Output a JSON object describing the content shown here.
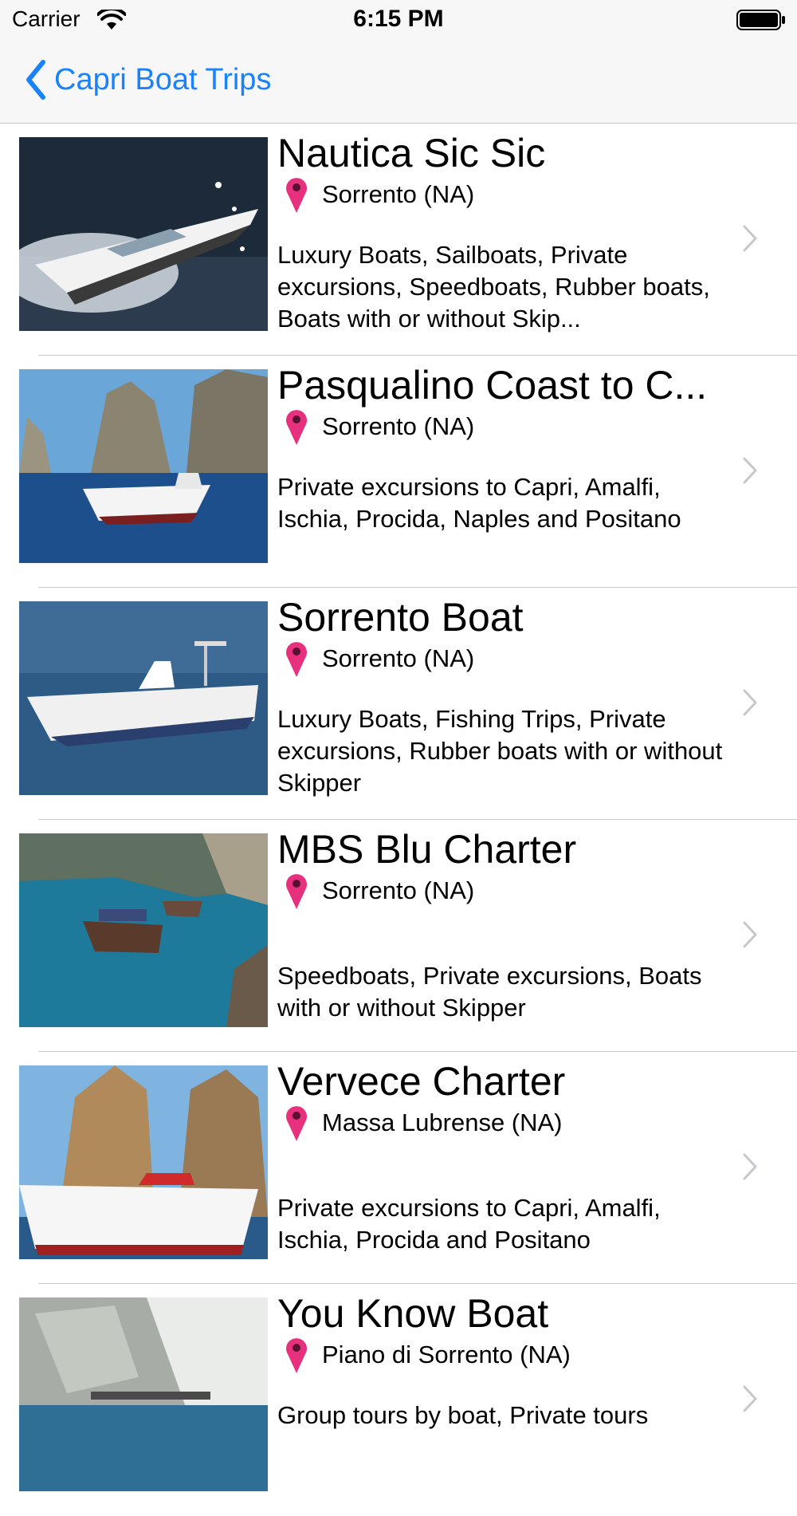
{
  "status_bar": {
    "carrier": "Carrier",
    "time": "6:15 PM"
  },
  "nav": {
    "back_label": "Capri Boat Trips",
    "accent_color": "#1a82fb"
  },
  "icons": {
    "location": "map-pin-icon",
    "disclosure": "chevron-right-icon",
    "back": "chevron-left-icon"
  },
  "items": [
    {
      "title": "Nautica Sic Sic",
      "location": "Sorrento (NA)",
      "description": "Luxury Boats, Sailboats, Private excursions, Speedboats, Rubber boats, Boats with or without Skip..."
    },
    {
      "title": "Pasqualino Coast to C...",
      "location": "Sorrento (NA)",
      "description": "Private excursions to Capri, Amalfi, Ischia, Procida, Naples and Positano"
    },
    {
      "title": "Sorrento Boat",
      "location": "Sorrento (NA)",
      "description": "Luxury Boats, Fishing Trips, Private excursions, Rubber boats with or without Skipper"
    },
    {
      "title": "MBS Blu Charter",
      "location": "Sorrento (NA)",
      "description": "Speedboats, Private excursions, Boats with or without Skipper"
    },
    {
      "title": "Vervece Charter",
      "location": "Massa Lubrense (NA)",
      "description": "Private excursions to Capri, Amalfi, Ischia, Procida and Positano"
    },
    {
      "title": "You Know Boat",
      "location": "Piano di Sorrento (NA)",
      "description": "Group tours by boat, Private tours"
    }
  ]
}
